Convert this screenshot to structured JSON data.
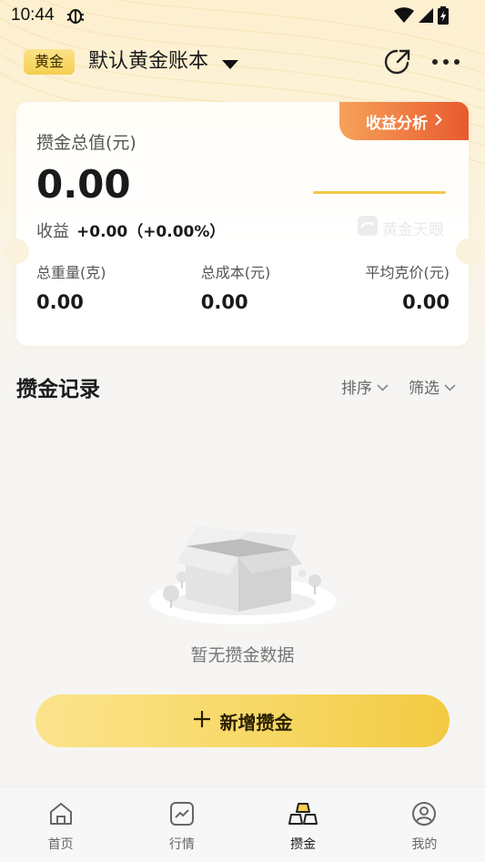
{
  "status_bar": {
    "time": "10:44"
  },
  "header": {
    "badge": "黄金",
    "book_name": "默认黄金账本"
  },
  "summary": {
    "analysis_label": "收益分析",
    "total_label": "攒金总值(元)",
    "total_value": "0.00",
    "profit_label": "收益",
    "profit_value": "+0.00（+0.00%）",
    "watermark": "黄金天眼",
    "stats": [
      {
        "label": "总重量(克)",
        "value": "0.00"
      },
      {
        "label": "总成本(元)",
        "value": "0.00"
      },
      {
        "label": "平均克价(元)",
        "value": "0.00"
      }
    ]
  },
  "records": {
    "title": "攒金记录",
    "sort_label": "排序",
    "filter_label": "筛选",
    "empty_text": "暂无攒金数据"
  },
  "add_button": {
    "label": "新增攒金"
  },
  "tabs": [
    {
      "label": "首页",
      "icon": "home-icon",
      "active": false
    },
    {
      "label": "行情",
      "icon": "market-chart-icon",
      "active": false
    },
    {
      "label": "攒金",
      "icon": "gold-bars-icon",
      "active": true
    },
    {
      "label": "我的",
      "icon": "profile-icon",
      "active": false
    }
  ],
  "colors": {
    "accent": "#f4cf4f",
    "analysis_tab": "#e85a2e",
    "background": "#f6f5f3"
  }
}
